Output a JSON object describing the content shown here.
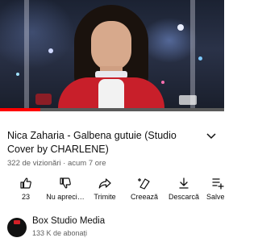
{
  "video": {
    "progress_fraction": 0.18,
    "colors": {
      "progress": "#ff0000",
      "track": "#5a5a5a"
    }
  },
  "title": "Nica Zaharia - Galbena gutuie (Studio Cover by CHARLENE)",
  "meta": "322 de vizionări · acum 7 ore",
  "actions": [
    {
      "label": "23",
      "icon": "like-icon"
    },
    {
      "label": "Nu apreci…",
      "icon": "dislike-icon"
    },
    {
      "label": "Trimite",
      "icon": "share-icon"
    },
    {
      "label": "Creează",
      "icon": "create-icon"
    },
    {
      "label": "Descarcă",
      "icon": "download-icon"
    },
    {
      "label": "Salve",
      "icon": "save-icon"
    }
  ],
  "channel": {
    "name": "Box Studio Media",
    "subscribers": "133 K de abonați"
  }
}
